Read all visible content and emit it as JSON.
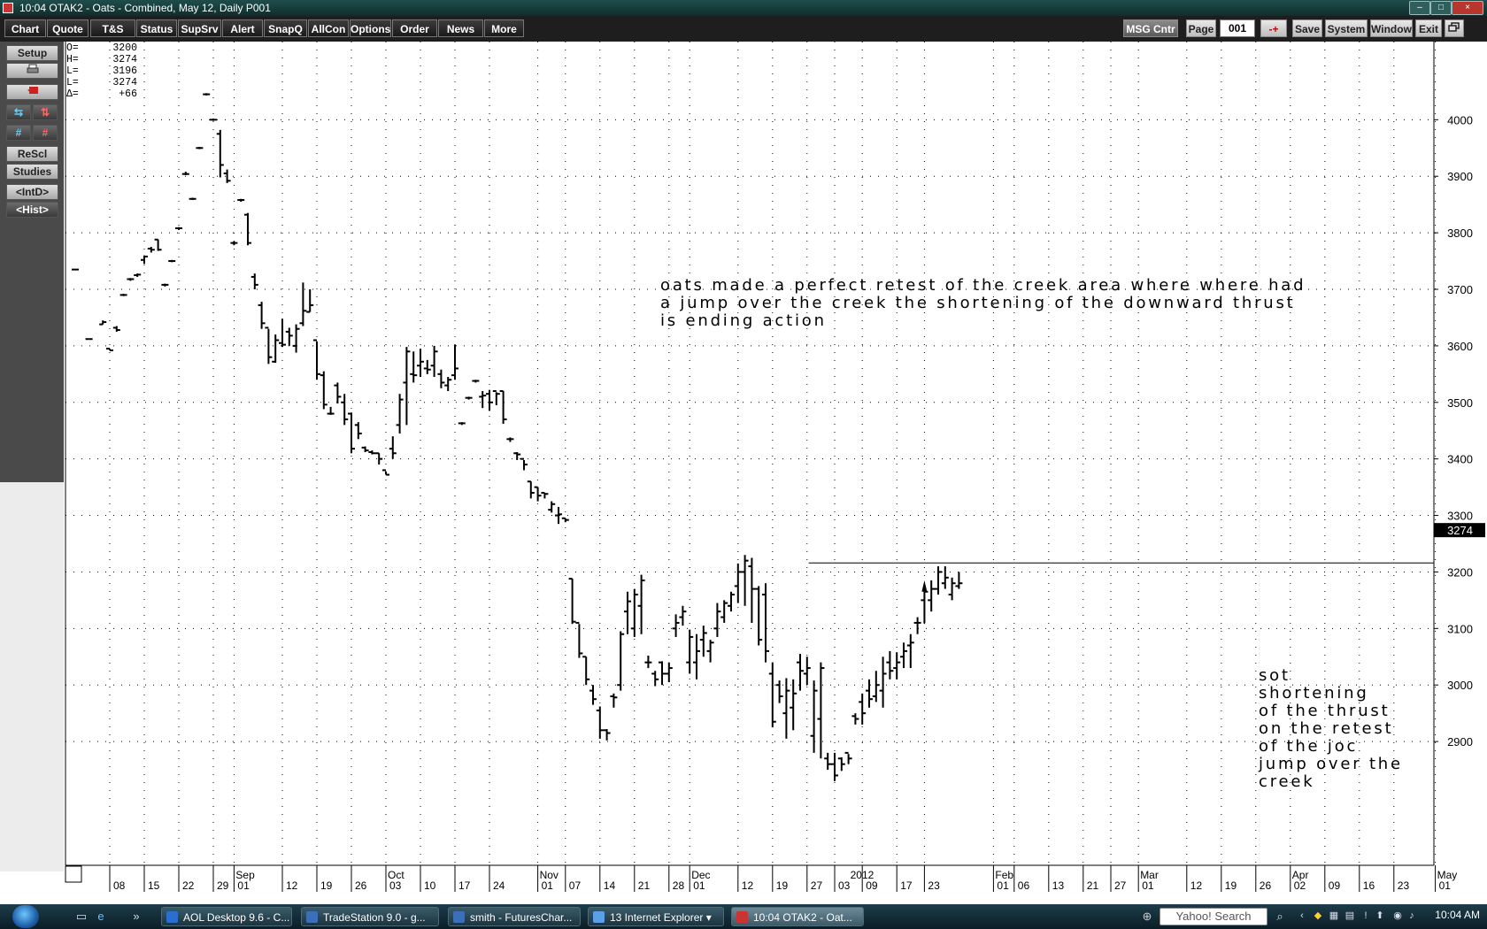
{
  "window": {
    "title": "10:04   OTAK2 - Oats - Combined, May 12, Daily   P001",
    "controls": [
      "–",
      "□",
      "×"
    ]
  },
  "toolbar": {
    "left_buttons": [
      "Chart",
      "Quote",
      "T&S",
      "Status",
      "SupSrv",
      "Alert",
      "SnapQ",
      "AllCon",
      "Options",
      "Order",
      "News",
      "More"
    ],
    "msg_center": "MSG Cntr",
    "page_label": "Page",
    "page_value": "001",
    "page_step": "-+",
    "right_buttons": [
      "Save",
      "System",
      "Window",
      "Exit"
    ],
    "restore_icon": "restore-icon"
  },
  "sidebar": {
    "setup": "Setup",
    "print_icon": "print-icon",
    "exit_icon": "red-exit-icon",
    "rescale": "ReScl",
    "studies": "Studies",
    "intraday": "<IntD>",
    "history": "<Hist>"
  },
  "ohlc": [
    {
      "label": "O=",
      "value": "3200"
    },
    {
      "label": "H=",
      "value": "3274"
    },
    {
      "label": "L=",
      "value": "3196"
    },
    {
      "label": "L=",
      "value": "3274"
    },
    {
      "label": "Δ=",
      "value": "+66"
    }
  ],
  "annotations": {
    "main": "oats made a perfect retest of the creek area where where had\na jump over the creek the shortening of the downward thrust\nis ending action",
    "side": "sot\nshortening\nof the thrust\non the retest\nof the joc\njump over the\ncreek"
  },
  "chart_data": {
    "type": "ohlc-bar",
    "symbol": "OTAK2",
    "y_ticks": [
      2900,
      3000,
      3100,
      3200,
      3300,
      3400,
      3500,
      3600,
      3700,
      3800,
      3900,
      4000
    ],
    "ylim": [
      2800,
      4060
    ],
    "last_price": 3274,
    "horizontal_line": 3216,
    "month_labels": [
      {
        "label": "Sep",
        "index": 23
      },
      {
        "label": "Oct",
        "index": 45
      },
      {
        "label": "Nov",
        "index": 67
      },
      {
        "label": "Dec",
        "index": 89
      },
      {
        "label": "2012",
        "index": 112
      },
      {
        "label": "Feb",
        "index": 133
      },
      {
        "label": "Mar",
        "index": 154
      },
      {
        "label": "Apr",
        "index": 176
      },
      {
        "label": "May",
        "index": 197
      }
    ],
    "day_labels": [
      {
        "label": "08",
        "index": 5
      },
      {
        "label": "15",
        "index": 10
      },
      {
        "label": "22",
        "index": 15
      },
      {
        "label": "29",
        "index": 20
      },
      {
        "label": "01",
        "index": 23
      },
      {
        "label": "12",
        "index": 30
      },
      {
        "label": "19",
        "index": 35
      },
      {
        "label": "26",
        "index": 40
      },
      {
        "label": "03",
        "index": 45
      },
      {
        "label": "10",
        "index": 50
      },
      {
        "label": "17",
        "index": 55
      },
      {
        "label": "24",
        "index": 60
      },
      {
        "label": "01",
        "index": 67
      },
      {
        "label": "07",
        "index": 71
      },
      {
        "label": "14",
        "index": 76
      },
      {
        "label": "21",
        "index": 81
      },
      {
        "label": "28",
        "index": 86
      },
      {
        "label": "01",
        "index": 89
      },
      {
        "label": "12",
        "index": 96
      },
      {
        "label": "19",
        "index": 101
      },
      {
        "label": "27",
        "index": 106
      },
      {
        "label": "03",
        "index": 110
      },
      {
        "label": "09",
        "index": 114
      },
      {
        "label": "17",
        "index": 119
      },
      {
        "label": "23",
        "index": 123
      },
      {
        "label": "01",
        "index": 133
      },
      {
        "label": "06",
        "index": 136
      },
      {
        "label": "13",
        "index": 141
      },
      {
        "label": "21",
        "index": 146
      },
      {
        "label": "27",
        "index": 150
      },
      {
        "label": "01",
        "index": 154
      },
      {
        "label": "12",
        "index": 161
      },
      {
        "label": "19",
        "index": 166
      },
      {
        "label": "26",
        "index": 171
      },
      {
        "label": "02",
        "index": 176
      },
      {
        "label": "09",
        "index": 181
      },
      {
        "label": "16",
        "index": 186
      },
      {
        "label": "23",
        "index": 191
      },
      {
        "label": "01",
        "index": 197
      }
    ],
    "x_count": 203,
    "bars": [
      [
        0,
        3735,
        3735,
        3735,
        3735
      ],
      [
        2,
        3612,
        3608,
        3608,
        3612
      ],
      [
        4,
        3638,
        3645,
        3638,
        3642
      ],
      [
        5,
        3595,
        3595,
        3592,
        3592
      ],
      [
        6,
        3632,
        3635,
        3625,
        3628
      ],
      [
        7,
        3690,
        3692,
        3688,
        3690
      ],
      [
        8,
        3718,
        3720,
        3715,
        3718
      ],
      [
        9,
        3725,
        3728,
        3722,
        3726
      ],
      [
        10,
        3752,
        3760,
        3745,
        3758
      ],
      [
        11,
        3772,
        3775,
        3765,
        3770
      ],
      [
        12,
        3788,
        3788,
        3768,
        3770
      ],
      [
        13,
        3708,
        3710,
        3705,
        3708
      ],
      [
        14,
        3750,
        3752,
        3748,
        3750
      ],
      [
        15,
        3808,
        3810,
        3805,
        3808
      ],
      [
        16,
        3904,
        3908,
        3902,
        3904
      ],
      [
        17,
        3860,
        3862,
        3858,
        3860
      ],
      [
        18,
        3950,
        3952,
        3948,
        3950
      ],
      [
        19,
        4045,
        4047,
        4043,
        4045
      ],
      [
        20,
        4000,
        4002,
        3998,
        4000
      ],
      [
        21,
        3975,
        3982,
        3898,
        3920
      ],
      [
        22,
        3905,
        3912,
        3888,
        3892
      ],
      [
        23,
        3782,
        3785,
        3778,
        3782
      ],
      [
        24,
        3858,
        3860,
        3855,
        3858
      ],
      [
        25,
        3832,
        3835,
        3778,
        3782
      ],
      [
        26,
        3722,
        3728,
        3700,
        3708
      ],
      [
        27,
        3672,
        3678,
        3630,
        3640
      ],
      [
        28,
        3632,
        3630,
        3568,
        3580
      ],
      [
        29,
        3572,
        3620,
        3570,
        3610
      ],
      [
        30,
        3605,
        3648,
        3598,
        3602
      ],
      [
        31,
        3625,
        3632,
        3600,
        3618
      ],
      [
        32,
        3600,
        3638,
        3588,
        3630
      ],
      [
        33,
        3640,
        3712,
        3635,
        3662
      ],
      [
        34,
        3660,
        3700,
        3660,
        3672
      ],
      [
        35,
        3610,
        3608,
        3540,
        3550
      ],
      [
        36,
        3548,
        3555,
        3488,
        3496
      ],
      [
        37,
        3480,
        3492,
        3478,
        3480
      ],
      [
        38,
        3530,
        3535,
        3498,
        3510
      ],
      [
        39,
        3500,
        3515,
        3460,
        3470
      ],
      [
        40,
        3480,
        3482,
        3410,
        3418
      ],
      [
        41,
        3460,
        3465,
        3435,
        3445
      ],
      [
        42,
        3420,
        3422,
        3412,
        3415
      ],
      [
        43,
        3412,
        3415,
        3408,
        3410
      ],
      [
        44,
        3410,
        3410,
        3390,
        3400
      ],
      [
        45,
        3380,
        3378,
        3372,
        3372
      ],
      [
        46,
        3418,
        3440,
        3400,
        3410
      ],
      [
        47,
        3460,
        3515,
        3445,
        3505
      ],
      [
        48,
        3535,
        3598,
        3460,
        3590
      ],
      [
        49,
        3550,
        3590,
        3535,
        3548
      ],
      [
        50,
        3565,
        3595,
        3545,
        3572
      ],
      [
        51,
        3560,
        3575,
        3550,
        3558
      ],
      [
        52,
        3565,
        3600,
        3545,
        3590
      ],
      [
        53,
        3550,
        3558,
        3525,
        3535
      ],
      [
        54,
        3530,
        3545,
        3520,
        3540
      ],
      [
        55,
        3548,
        3602,
        3540,
        3560
      ],
      [
        56,
        3463,
        3465,
        3460,
        3463
      ],
      [
        57,
        3508,
        3510,
        3505,
        3508
      ],
      [
        58,
        3538,
        3540,
        3535,
        3538
      ],
      [
        59,
        3510,
        3520,
        3490,
        3512
      ],
      [
        60,
        3515,
        3522,
        3485,
        3500
      ],
      [
        61,
        3520,
        3518,
        3495,
        3515
      ],
      [
        62,
        3520,
        3520,
        3462,
        3470
      ],
      [
        63,
        3435,
        3438,
        3430,
        3435
      ],
      [
        64,
        3410,
        3412,
        3398,
        3408
      ],
      [
        65,
        3400,
        3398,
        3380,
        3390
      ],
      [
        66,
        3360,
        3360,
        3330,
        3340
      ],
      [
        67,
        3350,
        3350,
        3325,
        3335
      ],
      [
        68,
        3340,
        3340,
        3330,
        3338
      ],
      [
        69,
        3310,
        3325,
        3305,
        3320
      ],
      [
        70,
        3300,
        3315,
        3285,
        3302
      ],
      [
        71,
        3295,
        3295,
        3288,
        3292
      ],
      [
        72,
        3188,
        3188,
        3108,
        3112
      ],
      [
        73,
        3110,
        3108,
        3048,
        3056
      ],
      [
        74,
        3050,
        3050,
        3000,
        3010
      ],
      [
        75,
        2990,
        3000,
        2965,
        2975
      ],
      [
        76,
        2955,
        2962,
        2905,
        2920
      ],
      [
        77,
        2920,
        2922,
        2902,
        2915
      ],
      [
        78,
        2980,
        2985,
        2960,
        2978
      ],
      [
        79,
        3000,
        3095,
        2990,
        3090
      ],
      [
        80,
        3130,
        3165,
        3090,
        3148
      ],
      [
        81,
        3100,
        3170,
        3085,
        3160
      ],
      [
        82,
        3140,
        3195,
        3090,
        3185
      ],
      [
        83,
        3040,
        3052,
        3030,
        3040
      ],
      [
        84,
        3020,
        3025,
        2998,
        3010
      ],
      [
        85,
        3040,
        3042,
        3000,
        3020
      ],
      [
        86,
        3020,
        3040,
        3005,
        3030
      ],
      [
        87,
        3100,
        3125,
        3085,
        3110
      ],
      [
        88,
        3120,
        3140,
        3105,
        3130
      ],
      [
        89,
        3040,
        3098,
        3020,
        3085
      ],
      [
        90,
        3040,
        3090,
        3010,
        3060
      ],
      [
        91,
        3080,
        3105,
        3050,
        3092
      ],
      [
        92,
        3060,
        3080,
        3040,
        3075
      ],
      [
        93,
        3100,
        3145,
        3085,
        3130
      ],
      [
        94,
        3120,
        3150,
        3110,
        3145
      ],
      [
        95,
        3140,
        3165,
        3130,
        3160
      ],
      [
        96,
        3175,
        3215,
        3145,
        3200
      ],
      [
        97,
        3200,
        3230,
        3140,
        3220
      ],
      [
        98,
        3210,
        3225,
        3110,
        3170
      ],
      [
        99,
        3170,
        3175,
        3070,
        3080
      ],
      [
        100,
        3160,
        3180,
        3040,
        3060
      ],
      [
        101,
        3020,
        3040,
        2925,
        2935
      ],
      [
        102,
        3000,
        3008,
        2968,
        2980
      ],
      [
        103,
        2950,
        3012,
        2905,
        2990
      ],
      [
        104,
        2960,
        3010,
        2920,
        2985
      ],
      [
        105,
        3040,
        3055,
        2990,
        3025
      ],
      [
        106,
        3020,
        3050,
        3000,
        3030
      ],
      [
        107,
        2910,
        3008,
        2880,
        2990
      ],
      [
        108,
        2940,
        3040,
        2870,
        3030
      ],
      [
        109,
        2870,
        2880,
        2850,
        2860
      ],
      [
        110,
        2860,
        2880,
        2830,
        2840
      ],
      [
        111,
        2870,
        2872,
        2848,
        2860
      ],
      [
        112,
        2880,
        2878,
        2860,
        2870
      ],
      [
        113,
        2945,
        2950,
        2930,
        2940
      ],
      [
        114,
        2970,
        2985,
        2930,
        2950
      ],
      [
        115,
        2990,
        3010,
        2960,
        2975
      ],
      [
        116,
        2980,
        3025,
        2970,
        3000
      ],
      [
        117,
        2990,
        3050,
        2960,
        3020
      ],
      [
        118,
        3040,
        3060,
        3010,
        3025
      ],
      [
        119,
        3030,
        3058,
        3010,
        3040
      ],
      [
        120,
        3050,
        3075,
        3030,
        3060
      ],
      [
        121,
        3070,
        3090,
        3030,
        3075
      ],
      [
        122,
        3110,
        3120,
        3090,
        3110
      ],
      [
        123,
        3150,
        3175,
        3110,
        3165
      ],
      [
        124,
        3150,
        3185,
        3130,
        3170
      ],
      [
        125,
        3170,
        3210,
        3160,
        3200
      ],
      [
        126,
        3180,
        3210,
        3170,
        3190
      ],
      [
        127,
        3160,
        3190,
        3150,
        3180
      ],
      [
        128,
        3175,
        3200,
        3170,
        3180
      ]
    ]
  }
}
